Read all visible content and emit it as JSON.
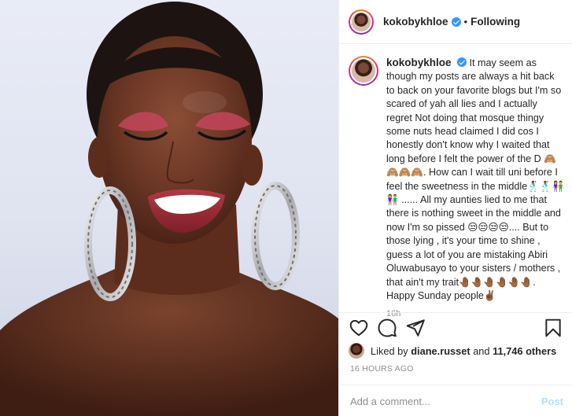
{
  "header": {
    "username": "kokobykhloe",
    "separator": "•",
    "follow_label": "Following"
  },
  "caption": {
    "username": "kokobykhloe",
    "text": "It may seem as though my posts are always a hit back to back on your favorite blogs but I'm so scared of yah all lies and I actually regret Not doing that mosque thingy some nuts head claimed I did cos I honestly don't know why I waited that long before I felt the power of the D 🙈🙈🙈🙈. How can I wait till uni before I feel the sweetness in the middle🕺🏾🕺🏾👫👫 ...... All my aunties lied to me that there is nothing sweet in the middle and now I'm so pissed 😒😒😒😒.... But to those lying , it's your time to shine , guess a lot of you are mistaking Abiri Oluwabusayo to your sisters / mothers , that ain't my trait🤚🏾🤚🏾🤚🏾🤚🏾🤚🏾🤚🏾. Happy Sunday people✌🏾",
    "age": "16h"
  },
  "likes": {
    "prefix": "Liked by",
    "user": "diane.russet",
    "middle": "and",
    "count": "11,746 others"
  },
  "timestamp": "16 HOURS AGO",
  "comment_box": {
    "placeholder": "Add a comment...",
    "post_label": "Post"
  },
  "icons": [
    "heart-icon",
    "comment-icon",
    "share-icon",
    "bookmark-icon"
  ],
  "colors": {
    "verified": "#3897f0",
    "post_disabled": "#b2dffc",
    "muted": "#8e8e8e"
  }
}
